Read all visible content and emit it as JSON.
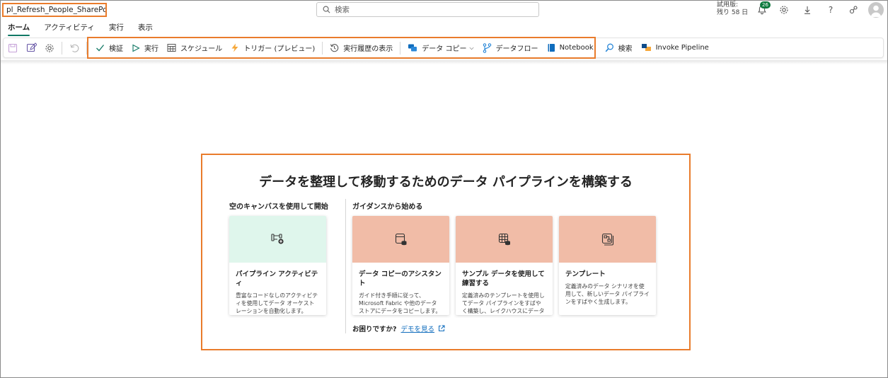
{
  "header": {
    "pipeline_name": "pl_Refresh_People_SharePoint",
    "search_placeholder": "検索",
    "trial_line1": "試用版:",
    "trial_line2": "残り 58 日",
    "notification_count": "26"
  },
  "tabs": [
    {
      "label": "ホーム",
      "active": true
    },
    {
      "label": "アクティビティ"
    },
    {
      "label": "実行"
    },
    {
      "label": "表示"
    }
  ],
  "ribbon": {
    "validate": "検証",
    "run": "実行",
    "schedule": "スケジュール",
    "trigger": "トリガー (プレビュー)",
    "view_run_history": "実行履歴の表示",
    "copy_data": "データ コピー",
    "dataflow": "データフロー",
    "notebook": "Notebook",
    "lookup": "検索",
    "invoke_pipeline": "Invoke Pipeline"
  },
  "main": {
    "headline": "データを整理して移動するためのデータ パイプラインを構築する",
    "blank_canvas_label": "空のキャンバスを使用して開始",
    "guidance_label": "ガイダンスから始める",
    "cards": [
      {
        "title": "パイプライン アクティビティ",
        "desc": "豊富なコードなしのアクティビティを使用してデータ オーケストレーションを自動化します。",
        "accent": "#dff6ec"
      },
      {
        "title": "データ コピーのアシスタント",
        "desc": "ガイド付き手順に従って、Microsoft Fabric や他のデータ ストアにデータをコピーします。",
        "accent": "#f1bca7"
      },
      {
        "title": "サンプル データを使用して練習する",
        "desc": "定義済みのテンプレートを使用してデータ パイプラインをすばやく構築し、レイクハウスにデータを読み込みます。",
        "accent": "#f1bca7"
      },
      {
        "title": "テンプレート",
        "desc": "定義済みのデータ シナリオを使用して、新しいデータ パイプラインをすばやく生成します。",
        "accent": "#f1bca7"
      }
    ],
    "help_question": "お困りですか?",
    "help_link": "デモを見る"
  },
  "colors": {
    "highlight": "#e97c2c",
    "tab_underline": "#117865",
    "link": "#0f6cbd"
  }
}
